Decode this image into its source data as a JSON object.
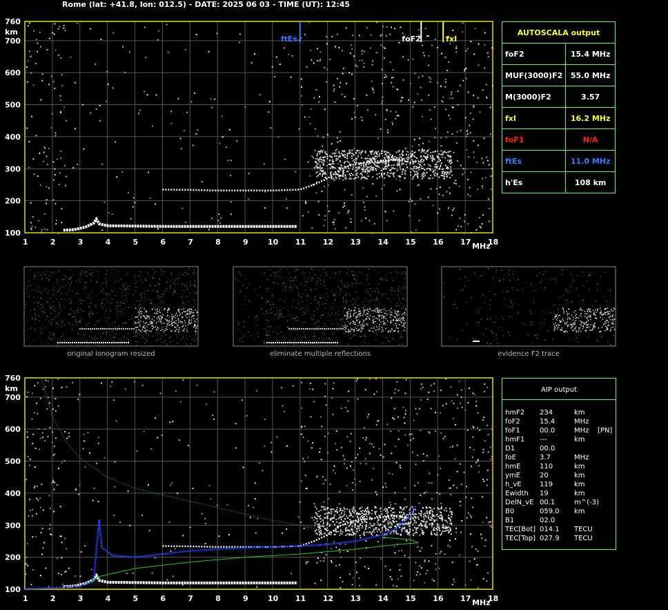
{
  "header": {
    "title": "Rome (lat: +41.8, lon: 012.5) - DATE: 2025 06 03 - TIME (UT): 12:45"
  },
  "axis": {
    "y_unit": "km",
    "x_unit": "MHz"
  },
  "markers": {
    "ftEs": "ftEs",
    "foF2": "foF2",
    "fxI": "fxI"
  },
  "autoscala": {
    "title": "AUTOSCALA output",
    "rows": [
      {
        "label": "foF2",
        "value": "15.4 MHz",
        "color": "#ffffff"
      },
      {
        "label": "MUF(3000)F2",
        "value": "55.0 MHz",
        "color": "#ffffff"
      },
      {
        "label": "M(3000)F2",
        "value": "3.57",
        "color": "#ffffff"
      },
      {
        "label": "fxI",
        "value": "16.2 MHz",
        "color": "#ffff33"
      },
      {
        "label": "foF1",
        "value": "N/A",
        "color": "#ff2020"
      },
      {
        "label": "ftEs",
        "value": "11.0 MHz",
        "color": "#3a7bff"
      },
      {
        "label": "h'Es",
        "value": "108    km",
        "color": "#ffffff"
      }
    ]
  },
  "thumbnails": [
    {
      "caption": "original ionogram resized"
    },
    {
      "caption": "eliminate multiple reflections"
    },
    {
      "caption": "evidence F2 trace"
    }
  ],
  "aip": {
    "title": "AIP output",
    "rows": [
      {
        "name": "hmF2",
        "value": "234",
        "unit": "km",
        "extra": ""
      },
      {
        "name": "foF2",
        "value": "15.4",
        "unit": "MHz",
        "extra": ""
      },
      {
        "name": "foF1",
        "value": "00.0",
        "unit": "MHz",
        "extra": "[PN]"
      },
      {
        "name": "hmF1",
        "value": "---",
        "unit": "km",
        "extra": ""
      },
      {
        "name": "D1",
        "value": "00.0",
        "unit": "",
        "extra": ""
      },
      {
        "name": "foE",
        "value": "3.7",
        "unit": "MHz",
        "extra": ""
      },
      {
        "name": "hmE",
        "value": "110",
        "unit": "km",
        "extra": ""
      },
      {
        "name": "ymE",
        "value": "20",
        "unit": "km",
        "extra": ""
      },
      {
        "name": "h_vE",
        "value": "119",
        "unit": "km",
        "extra": ""
      },
      {
        "name": "Ewidth",
        "value": "19",
        "unit": "km",
        "extra": ""
      },
      {
        "name": "DelN_vE",
        "value": "00.1",
        "unit": "m^(-3)",
        "extra": ""
      },
      {
        "name": "B0",
        "value": "059.0",
        "unit": "km",
        "extra": ""
      },
      {
        "name": "B1",
        "value": "02.0",
        "unit": "",
        "extra": ""
      },
      {
        "name": "TEC[Bot]",
        "value": "014.1",
        "unit": "TECU",
        "extra": ""
      },
      {
        "name": "TEC[Top]",
        "value": "027.9",
        "unit": "TECU",
        "extra": ""
      }
    ]
  },
  "chart_data": [
    {
      "type": "scatter",
      "xlim": [
        1,
        18
      ],
      "ylim": [
        100,
        760
      ],
      "xticks": [
        1,
        2,
        3,
        4,
        5,
        6,
        7,
        8,
        9,
        10,
        11,
        12,
        13,
        14,
        15,
        16,
        17,
        18
      ],
      "yticks": [
        100,
        200,
        300,
        400,
        500,
        600,
        700,
        760
      ],
      "grid": true,
      "ftEs": 11.0,
      "foF2": 15.4,
      "fxI": 16.2,
      "traces": [
        {
          "role": "E/Es",
          "x": [
            2.4,
            2.8,
            3.2,
            3.5,
            3.6,
            3.7,
            4.0,
            5,
            6,
            7,
            8,
            9,
            10,
            10.9
          ],
          "y": [
            108,
            110,
            118,
            130,
            143,
            128,
            122,
            121,
            120,
            120,
            120,
            120,
            120,
            120
          ]
        },
        {
          "role": "F2",
          "x": [
            6.0,
            7,
            8,
            9,
            10,
            11.0,
            11.5,
            12.0,
            12.5,
            13,
            13.5,
            14,
            14.5,
            15,
            15.3
          ],
          "y": [
            235,
            234,
            232,
            232,
            232,
            235,
            250,
            270,
            300,
            315,
            320,
            325,
            330,
            320,
            325
          ]
        }
      ]
    },
    {
      "type": "scatter",
      "xlim": [
        1,
        18
      ],
      "ylim": [
        100,
        760
      ],
      "xticks": [
        1,
        2,
        3,
        4,
        5,
        6,
        7,
        8,
        9,
        10,
        11,
        12,
        13,
        14,
        15,
        16,
        17,
        18
      ],
      "yticks": [
        100,
        200,
        300,
        400,
        500,
        600,
        700,
        760
      ],
      "grid": true,
      "profile_blue": {
        "x": [
          1,
          2,
          3,
          3.5,
          3.7,
          3.8,
          4.2,
          5,
          6,
          7,
          8,
          9,
          10,
          11,
          12,
          13,
          14,
          14.5,
          15,
          15.2
        ],
        "y": [
          101,
          104,
          110,
          125,
          318,
          230,
          205,
          200,
          210,
          220,
          225,
          230,
          232,
          235,
          240,
          250,
          270,
          290,
          330,
          360
        ]
      },
      "profile_green": {
        "x": [
          1.6,
          2,
          2.5,
          3,
          4,
          5,
          6,
          7,
          8,
          9,
          10,
          11,
          11.5
        ],
        "y": [
          760,
          640,
          560,
          510,
          450,
          415,
          395,
          375,
          355,
          335,
          315,
          300,
          290
        ]
      },
      "profile_green_low": {
        "x": [
          3.3,
          3.7,
          5,
          7,
          9,
          11,
          13,
          14.5,
          15.3,
          15.0,
          14
        ],
        "y": [
          120,
          140,
          165,
          185,
          200,
          210,
          225,
          240,
          245,
          255,
          262
        ]
      }
    }
  ]
}
